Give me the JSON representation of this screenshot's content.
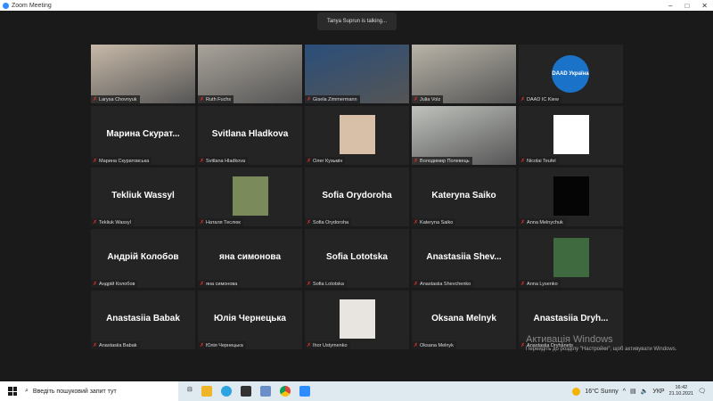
{
  "window": {
    "title": "Zoom Meeting"
  },
  "talking": "Tanya Suprun is talking...",
  "tiles": [
    {
      "label": "Larysa Chovnyuk",
      "type": "video",
      "color": "#c7b9a8"
    },
    {
      "label": "Ruth Fuchs",
      "type": "video",
      "color": "#a9a39a"
    },
    {
      "label": "Gisela Zimmermann",
      "type": "video",
      "color": "#2a4e7a"
    },
    {
      "label": "Julia Volz",
      "type": "video",
      "color": "#b9b4a8"
    },
    {
      "label": "DAAD IC Kiew",
      "type": "logo",
      "logo": "DAAD Україна",
      "color": "#1a73c8"
    },
    {
      "label": "Марина Скуратовська",
      "big": "Марина  Скурат..."
    },
    {
      "label": "Svitlana Hladkova",
      "big": "Svitlana Hladkova"
    },
    {
      "label": "Олег Кузьмін",
      "type": "pic",
      "color": "#d8c0a8"
    },
    {
      "label": "Володимир Полевець",
      "type": "video",
      "color": "#bfc2bd"
    },
    {
      "label": "Nicolai Teufel",
      "type": "pic",
      "color": "#ffffff"
    },
    {
      "label": "Tekliuk Wassyl",
      "big": "Tekliuk Wassyl"
    },
    {
      "label": "Наталя Теслюк",
      "type": "pic",
      "color": "#7a8a5a"
    },
    {
      "label": "Sofia Orydoroha",
      "big": "Sofia Orydoroha"
    },
    {
      "label": "Kateryna Saiko",
      "big": "Kateryna Saiko"
    },
    {
      "label": "Anna Melnychuk",
      "type": "pic",
      "color": "#050505"
    },
    {
      "label": "Андрій Колобов",
      "big": "Андрій Колобов"
    },
    {
      "label": "яна симонова",
      "big": "яна симонова"
    },
    {
      "label": "Sofia Lototska",
      "big": "Sofia Lototska"
    },
    {
      "label": "Anastasiia Shevchenko",
      "big": "Anastasiia  Shev..."
    },
    {
      "label": "Anna Lysenko",
      "type": "pic",
      "color": "#3f6a40"
    },
    {
      "label": "Anastasiia Babak",
      "big": "Anastasiia Babak"
    },
    {
      "label": "Юлія Чернецька",
      "big": "Юлія Чернецька"
    },
    {
      "label": "Ihor Ustymenko",
      "type": "pic",
      "color": "#e8e4e0"
    },
    {
      "label": "Oksana Melnyk",
      "big": "Oksana Melnyk"
    },
    {
      "label": "Anastasiia Dryhanets",
      "big": "Anastasiia  Dryh..."
    }
  ],
  "watermark": {
    "title": "Активація Windows",
    "text": "Перейдіть до розділу \"Настройки\", щоб активувати Windows."
  },
  "taskbar": {
    "search_placeholder": "Введіть пошуковий запит тут",
    "weather": "16°C  Sunny",
    "lang": "УКР",
    "time": "16:42",
    "date": "21.10.2021"
  }
}
